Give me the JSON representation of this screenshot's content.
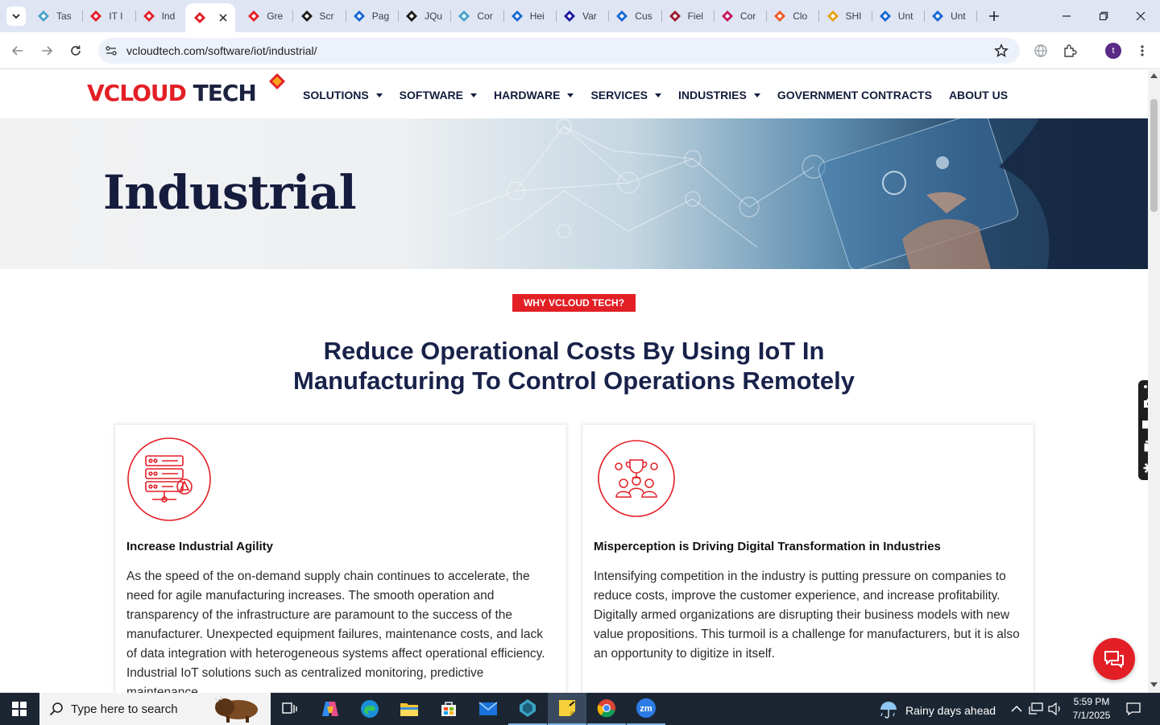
{
  "browser": {
    "tabs": [
      {
        "label": "Tas",
        "color": "#4aa3c7"
      },
      {
        "label": "IT I",
        "color": "#e31f26"
      },
      {
        "label": "Ind",
        "color": "#e31f26"
      },
      {
        "label": "",
        "color": "#e31f26",
        "active": true
      },
      {
        "label": "Gre",
        "color": "#e31f26"
      },
      {
        "label": "Scr",
        "color": "#1a1a1a"
      },
      {
        "label": "Pag",
        "color": "#1967d2"
      },
      {
        "label": "JQu",
        "color": "#1a1a1a"
      },
      {
        "label": "Cor",
        "color": "#4aa3c7"
      },
      {
        "label": "Hei",
        "color": "#1967d2"
      },
      {
        "label": "Var",
        "color": "#1a1aa0"
      },
      {
        "label": "Cus",
        "color": "#1967d2"
      },
      {
        "label": "Fiel",
        "color": "#9b1b30"
      },
      {
        "label": "Cor",
        "color": "#c2185b"
      },
      {
        "label": "Clo",
        "color": "#f05a28"
      },
      {
        "label": "SHI",
        "color": "#e8a317"
      },
      {
        "label": "Unt",
        "color": "#1967d2"
      },
      {
        "label": "Unt",
        "color": "#1967d2"
      }
    ],
    "url": "vcloudtech.com/software/iot/industrial/",
    "profile_initial": "t"
  },
  "site": {
    "logo": {
      "part1": "V",
      "part2": "CLOUD",
      "part3": "TECH"
    },
    "nav": [
      {
        "label": "SOLUTIONS",
        "dropdown": true
      },
      {
        "label": "SOFTWARE",
        "dropdown": true
      },
      {
        "label": "HARDWARE",
        "dropdown": true
      },
      {
        "label": "SERVICES",
        "dropdown": true
      },
      {
        "label": "INDUSTRIES",
        "dropdown": true
      },
      {
        "label": "GOVERNMENT CONTRACTS",
        "dropdown": false
      },
      {
        "label": "ABOUT US",
        "dropdown": false
      }
    ],
    "hero_title": "Industrial",
    "badge": "WHY VCLOUD TECH?",
    "headline_line1": "Reduce Operational Costs By Using IoT In",
    "headline_line2": "Manufacturing To Control Operations Remotely",
    "cards": [
      {
        "icon": "server-warning-icon",
        "title": "Increase Industrial Agility",
        "body": "As the speed of the on-demand supply chain continues to accelerate, the need for agile manufacturing increases. The smooth operation and transparency of the infrastructure are paramount to the success of the manufacturer. Unexpected equipment failures, maintenance costs, and lack of data integration with heterogeneous systems affect operational efficiency. Industrial IoT solutions such as centralized monitoring, predictive maintenance"
      },
      {
        "icon": "team-trophy-icon",
        "title": "Misperception is Driving Digital Transformation in Industries",
        "body": "Intensifying competition in the industry is putting pressure on companies to reduce costs, improve the customer experience, and increase profitability. Digitally armed organizations are disrupting their business models with new value propositions. This turmoil is a challenge for manufacturers, but it is also an opportunity to digitize in itself."
      }
    ]
  },
  "taskbar": {
    "search_placeholder": "Type here to search",
    "weather": "Rainy days ahead",
    "time": "5:59 PM",
    "date": "7/1/2025"
  },
  "colors": {
    "brand_red": "#e31f26",
    "brand_navy": "#18224a"
  }
}
